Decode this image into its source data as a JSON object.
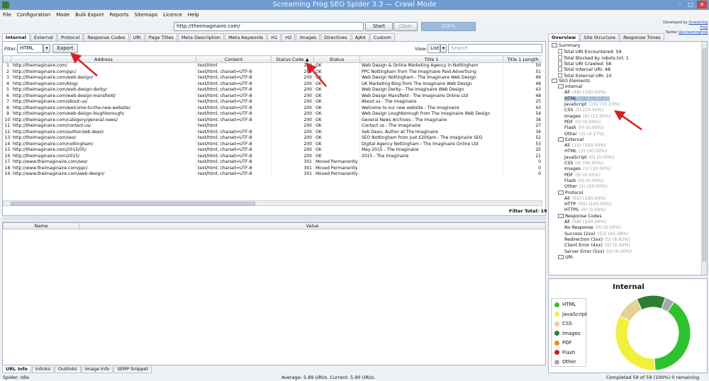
{
  "window": {
    "title": "Screaming Frog SEO Spider 3.3  —  Crawl Mode"
  },
  "menu": [
    "File",
    "Configuration",
    "Mode",
    "Bulk Export",
    "Reports",
    "Sitemaps",
    "Licence",
    "Help"
  ],
  "toolbar": {
    "url": "http://theimaginaire.com/",
    "start": "Start",
    "clear": "Clear",
    "progress": "100%"
  },
  "brand": {
    "line1": "Developed by",
    "link1": "Screaming Frog",
    "line2": "Twitter",
    "link2": "@screamingfrog"
  },
  "tabs": [
    "Internal",
    "External",
    "Protocol",
    "Response Codes",
    "URI",
    "Page Titles",
    "Meta Description",
    "Meta Keywords",
    "H1",
    "H2",
    "Images",
    "Directives",
    "AJAX",
    "Custom"
  ],
  "filter": {
    "label": "Filter:",
    "value": "HTML",
    "export": "Export",
    "view_label": "View:",
    "view_value": "List",
    "search_placeholder": "Search"
  },
  "table": {
    "headers": [
      "Address",
      "Content",
      "Status Code",
      "Status",
      "Title 1",
      "Title 1 Length"
    ],
    "rows": [
      [
        "1",
        "http://theimaginaire.com/",
        "text/html",
        "200",
        "OK",
        "Web Design & Online Marketing Agency in Nottingham",
        "50"
      ],
      [
        "2",
        "http://theimaginaire.com/ppc/",
        "text/html; charset=UTF-8",
        "200",
        "OK",
        "PPC Nottingham from The Imaginaire Paid Advertising",
        "51"
      ],
      [
        "3",
        "http://theimaginaire.com/web-design/",
        "text/html; charset=UTF-8",
        "200",
        "OK",
        "Web Design Nottingham - The Imaginaire Web Design",
        "49"
      ],
      [
        "4",
        "http://theimaginaire.com/blog/",
        "text/html; charset=UTF-8",
        "200",
        "OK",
        "UK Marketing Blog from The Imaginaire Web Design",
        "48"
      ],
      [
        "5",
        "http://theimaginaire.com/web-design-derby/",
        "text/html; charset=UTF-8",
        "200",
        "OK",
        "Web Design Derby - The Imaginaire Web Design",
        "43"
      ],
      [
        "6",
        "http://theimaginaire.com/web-design-mansfield/",
        "text/html; charset=UTF-8",
        "200",
        "OK",
        "Web Design Mansfield - The Imaginaire Online Ltd",
        "48"
      ],
      [
        "7",
        "http://theimaginaire.com/about-us/",
        "text/html; charset=UTF-8",
        "200",
        "OK",
        "About us - The Imaginaire",
        "25"
      ],
      [
        "8",
        "http://theimaginaire.com/welcome-to-the-new-website/",
        "text/html; charset=UTF-8",
        "200",
        "OK",
        "Welcome to our new website - The Imaginaire",
        "43"
      ],
      [
        "9",
        "http://theimaginaire.com/web-design-loughborough/",
        "text/html; charset=UTF-8",
        "200",
        "OK",
        "Web Design Loughborough from The Imaginaire Web Design",
        "54"
      ],
      [
        "10",
        "http://theimaginaire.com/category/general-news/",
        "text/html; charset=UTF-8",
        "200",
        "OK",
        "General News Archives - The Imaginaire",
        "38"
      ],
      [
        "11",
        "http://theimaginaire.com/contact-us/",
        "text/html",
        "200",
        "OK",
        "Contact us - The Imaginaire",
        "27"
      ],
      [
        "12",
        "http://theimaginaire.com/author/seb-dean/",
        "text/html; charset=UTF-8",
        "200",
        "OK",
        "Seb Dean, Author at The Imaginaire",
        "34"
      ],
      [
        "13",
        "http://theimaginaire.com/seo/",
        "text/html; charset=UTF-8",
        "200",
        "OK",
        "SEO Nottingham from just £200pm - The Imaginaire SEO",
        "52"
      ],
      [
        "14",
        "http://theimaginaire.com/nottingham/",
        "text/html; charset=UTF-8",
        "200",
        "OK",
        "Digital Agency Nottingham - The Imaginaire Online Ltd",
        "53"
      ],
      [
        "15",
        "http://theimaginaire.com/2015/05/",
        "text/html; charset=UTF-8",
        "200",
        "OK",
        "May 2015 - The Imaginaire",
        "25"
      ],
      [
        "16",
        "http://theimaginaire.com/2015/",
        "text/html; charset=UTF-8",
        "200",
        "OK",
        "2015 - The Imaginaire",
        "21"
      ],
      [
        "17",
        "http://www.theimaginaire.com/seo/",
        "text/html; charset=UTF-8",
        "301",
        "Moved Permanently",
        "",
        "0"
      ],
      [
        "18",
        "http://www.theimaginaire.com/ppc/",
        "text/html; charset=UTF-8",
        "301",
        "Moved Permanently",
        "",
        "0"
      ],
      [
        "19",
        "http://www.theimaginaire.com/web-design/",
        "text/html; charset=UTF-8",
        "301",
        "Moved Permanently",
        "",
        "0"
      ]
    ],
    "filter_total_label": "Filter Total:",
    "filter_total": "19"
  },
  "detail": {
    "headers": [
      "Name",
      "Value"
    ]
  },
  "bottom_tabs": [
    "URL Info",
    "Inlinks",
    "Outlinks",
    "Image Info",
    "SERP Snippet"
  ],
  "status": {
    "left": "Spider: Idle",
    "middle": "Average: 5.89 URI/s. Current: 5.90 URI/s.",
    "right": "Completed 59 of 59 (100%) 0 remaining"
  },
  "right_tabs": [
    "Overview",
    "Site Structure",
    "Response Times"
  ],
  "tree": [
    {
      "level": 0,
      "icon": "folder",
      "label": "Summary",
      "gray": ""
    },
    {
      "level": 1,
      "icon": "doc",
      "label": "Total URI Encountered: 59",
      "gray": ""
    },
    {
      "level": 1,
      "icon": "doc",
      "label": "Total Blocked by robots.txt: 1",
      "gray": ""
    },
    {
      "level": 1,
      "icon": "doc",
      "label": "Total URI Crawled: 58",
      "gray": ""
    },
    {
      "level": 1,
      "icon": "doc",
      "label": "Total Internal URI: 48",
      "gray": ""
    },
    {
      "level": 1,
      "icon": "doc",
      "label": "Total External URI: 10",
      "gray": ""
    },
    {
      "level": 0,
      "icon": "folder",
      "label": "SEO Elements",
      "gray": ""
    },
    {
      "level": 1,
      "icon": "folder",
      "label": "Internal",
      "gray": ""
    },
    {
      "level": 2,
      "icon": "",
      "label": "All",
      "gray": "(48) (100.00%)"
    },
    {
      "level": 2,
      "icon": "",
      "label": "HTML",
      "gray": "(19) (39.58%)",
      "selected": true
    },
    {
      "level": 2,
      "icon": "",
      "label": "JavaScript",
      "gray": "(16) (33.33%)"
    },
    {
      "level": 2,
      "icon": "",
      "label": "CSS",
      "gray": "(5) (10.42%)"
    },
    {
      "level": 2,
      "icon": "",
      "label": "Images",
      "gray": "(6) (12.50%)"
    },
    {
      "level": 2,
      "icon": "",
      "label": "PDF",
      "gray": "(0) (0.00%)"
    },
    {
      "level": 2,
      "icon": "",
      "label": "Flash",
      "gray": "(0) (0.00%)"
    },
    {
      "level": 2,
      "icon": "",
      "label": "Other",
      "gray": "(2) (4.17%)"
    },
    {
      "level": 1,
      "icon": "folder",
      "label": "External",
      "gray": ""
    },
    {
      "level": 2,
      "icon": "",
      "label": "All",
      "gray": "(10) (100.00%)"
    },
    {
      "level": 2,
      "icon": "",
      "label": "HTML",
      "gray": "(3) (30.00%)"
    },
    {
      "level": 2,
      "icon": "",
      "label": "JavaScript",
      "gray": "(0) (0.00%)"
    },
    {
      "level": 2,
      "icon": "",
      "label": "CSS",
      "gray": "(4) (40.00%)"
    },
    {
      "level": 2,
      "icon": "",
      "label": "Images",
      "gray": "(1) (10.00%)"
    },
    {
      "level": 2,
      "icon": "",
      "label": "PDF",
      "gray": "(0) (0.00%)"
    },
    {
      "level": 2,
      "icon": "",
      "label": "Flash",
      "gray": "(0) (0.00%)"
    },
    {
      "level": 2,
      "icon": "",
      "label": "Other",
      "gray": "(2) (20.00%)"
    },
    {
      "level": 1,
      "icon": "folder",
      "label": "Protocol",
      "gray": ""
    },
    {
      "level": 2,
      "icon": "",
      "label": "All",
      "gray": "(55) (100.00%)"
    },
    {
      "level": 2,
      "icon": "",
      "label": "HTTP",
      "gray": "(55) (100.00%)"
    },
    {
      "level": 2,
      "icon": "",
      "label": "HTTPS",
      "gray": "(0) (0.00%)"
    },
    {
      "level": 1,
      "icon": "folder",
      "label": "Response Codes",
      "gray": ""
    },
    {
      "level": 2,
      "icon": "",
      "label": "All",
      "gray": "(58) (100.00%)"
    },
    {
      "level": 2,
      "icon": "",
      "label": "No Response",
      "gray": "(0) (0.00%)"
    },
    {
      "level": 2,
      "icon": "",
      "label": "Success (2xx)",
      "gray": "(53) (91.38%)"
    },
    {
      "level": 2,
      "icon": "",
      "label": "Redirection (3xx)",
      "gray": "(5) (8.62%)"
    },
    {
      "level": 2,
      "icon": "",
      "label": "Client Error (4xx)",
      "gray": "(0) (0.00%)"
    },
    {
      "level": 2,
      "icon": "",
      "label": "Server Error (5xx)",
      "gray": "(0) (0.00%)"
    },
    {
      "level": 1,
      "icon": "folder",
      "label": "URI",
      "gray": ""
    }
  ],
  "chart_data": {
    "type": "pie",
    "title": "Internal",
    "categories": [
      "HTML",
      "JavaScript",
      "CSS",
      "Images",
      "PDF",
      "Flash",
      "Other"
    ],
    "values": [
      19,
      16,
      5,
      6,
      0,
      0,
      2
    ],
    "colors": [
      "#2fc22f",
      "#f2f03c",
      "#e4d28f",
      "#2f7d2f",
      "#ee8a1a",
      "#d51a1a",
      "#a8a8a8"
    ]
  }
}
